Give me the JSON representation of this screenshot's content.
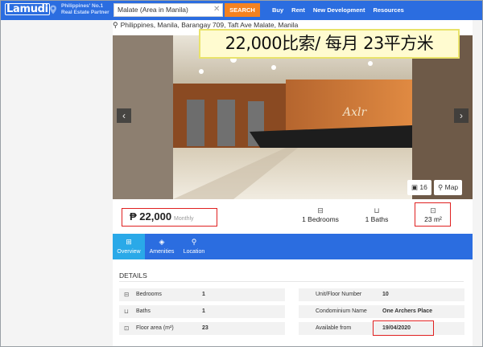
{
  "header": {
    "logo_text": "Lamudi",
    "tagline_line1": "Philippines' No.1",
    "tagline_line2": "Real Estate Partner",
    "search_value": "Malate (Area in Manila)",
    "search_button": "SEARCH",
    "nav": [
      "Buy",
      "Rent",
      "New Development",
      "Resources"
    ]
  },
  "listing": {
    "address": "Philippines, Manila, Barangay 709, Taft Ave Malate, Manila",
    "overlay_title": "22,000比索/ 每月  23平方米",
    "photo_count": "16",
    "map_label": "Map",
    "price": "₱ 22,000",
    "price_unit": "Monthly",
    "bedrooms": "1 Bedrooms",
    "baths": "1 Baths",
    "area": "23 m²"
  },
  "tabs": [
    {
      "label": "Overview",
      "icon": "grid-icon"
    },
    {
      "label": "Amenities",
      "icon": "cube-icon"
    },
    {
      "label": "Location",
      "icon": "pin-icon"
    }
  ],
  "details": {
    "heading": "DETAILS",
    "left": [
      {
        "label": "Bedrooms",
        "value": "1",
        "icon": "bed-icon"
      },
      {
        "label": "Baths",
        "value": "1",
        "icon": "bath-icon"
      },
      {
        "label": "Floor area (m²)",
        "value": "23",
        "icon": "area-icon"
      }
    ],
    "right": [
      {
        "label": "Unit/Floor Number",
        "value": "10"
      },
      {
        "label": "Condominium Name",
        "value": "One Archers Place"
      },
      {
        "label": "Available from",
        "value": "19/04/2020"
      }
    ]
  },
  "colors": {
    "brand_blue": "#2b6de0",
    "active_tab": "#2aa9e8",
    "search_orange": "#f5821f",
    "highlight_red": "#e02020"
  }
}
